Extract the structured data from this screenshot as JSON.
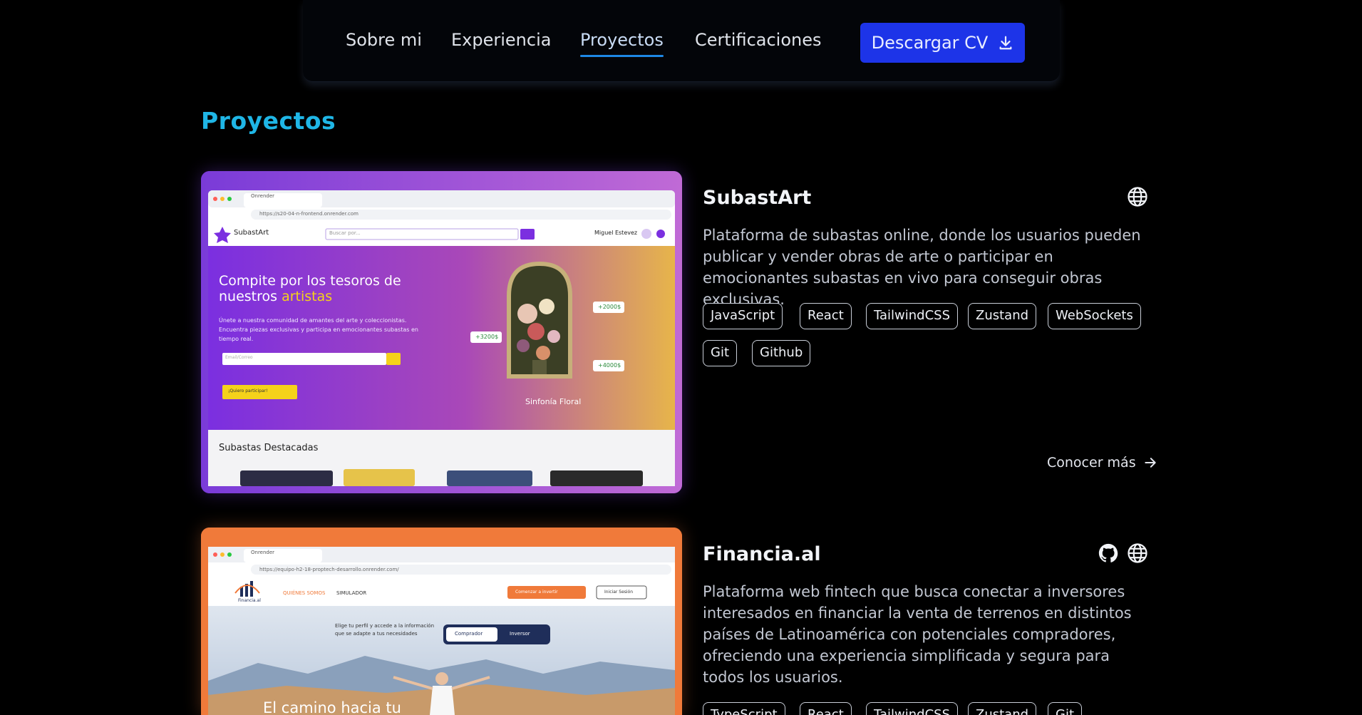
{
  "nav": {
    "items": [
      "Sobre mi",
      "Experiencia",
      "Proyectos",
      "Certificaciones"
    ],
    "active": "Proyectos",
    "cv_label": "Descargar CV"
  },
  "section_title": "Proyectos",
  "projects": [
    {
      "title": "SubastArt",
      "description": "Plataforma de subastas online, donde los usuarios pueden publicar y vender obras de arte o participar en emocionantes subastas en vivo para conseguir obras exclusivas.",
      "tags": [
        "JavaScript",
        "React",
        "TailwindCSS",
        "Zustand",
        "WebSockets",
        "Git",
        "Github"
      ],
      "links": [
        "globe-icon"
      ],
      "more_label": "Conocer más",
      "screenshot": {
        "url": "https://s20-04-n-frontend.onrender.com",
        "tab": "Onrender",
        "brand": "SubastArt",
        "search_placeholder": "Buscar por...",
        "user": "Miguel Estevez",
        "hero_line1": "Compite por los tesoros de",
        "hero_line2": "nuestros",
        "hero_highlight": "artistas",
        "hero_text": "Únete a nuestra comunidad de amantes del arte y coleccionistas. Encuentra piezas exclusivas y participa en emocionantes subastas en tiempo real.",
        "input_placeholder": "Email/Correo",
        "cta": "¡Quiero participar!",
        "painting_title": "Sinfonía Floral",
        "bids": [
          "+2000$",
          "+3200$",
          "+4000$"
        ],
        "featured": "Subastas Destacadas"
      }
    },
    {
      "title": "Financia.al",
      "description": "Plataforma web fintech que busca conectar a inversores interesados en financiar la venta de terrenos en distintos países de Latinoamérica con potenciales compradores, ofreciendo una experiencia simplificada y segura para todos los usuarios.",
      "tags": [
        "TypeScript",
        "React",
        "TailwindCSS",
        "Zustand",
        "Git"
      ],
      "links": [
        "github-icon",
        "globe-icon"
      ],
      "screenshot": {
        "url": "https://equipo-h2-18-proptech-desarrollo.onrender.com/",
        "tab": "Onrender",
        "brand": "Financia.al",
        "menu": [
          "QUIÉNES SOMOS",
          "SIMULADOR"
        ],
        "cta": "Comenzar a invertir",
        "login": "Iniciar Sesión",
        "prompt": "Elige tu perfil y accede a la información que se adapte a tus necesidades",
        "toggle": [
          "Comprador",
          "Inversor"
        ],
        "hero": "El camino hacia tu"
      }
    }
  ],
  "colors": {
    "accent": "#1fb6e6",
    "button": "#1d34e8",
    "active_underline": "#1e88e5",
    "purple": "#7a2fd6",
    "orange": "#f07a3a"
  }
}
